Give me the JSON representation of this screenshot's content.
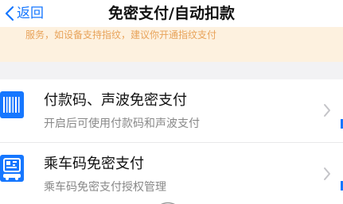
{
  "nav": {
    "back_label": "返回",
    "title": "免密支付/自动扣款"
  },
  "notice": {
    "text": "服务，如设备支持指纹，建议你开通指纹支付"
  },
  "items": [
    {
      "title": "付款码、声波免密支付",
      "subtitle": "开启后可使用付款码和声波支付",
      "icon": "barcode-icon"
    },
    {
      "title": "乘车码免密支付",
      "subtitle": "乘车码免密支付授权管理",
      "icon": "transit-code-icon"
    }
  ],
  "colors": {
    "accent": "#1677ff",
    "notice_bg": "#fdf1df",
    "notice_text": "#e8a35a",
    "page_bg": "#f2f2f4"
  }
}
